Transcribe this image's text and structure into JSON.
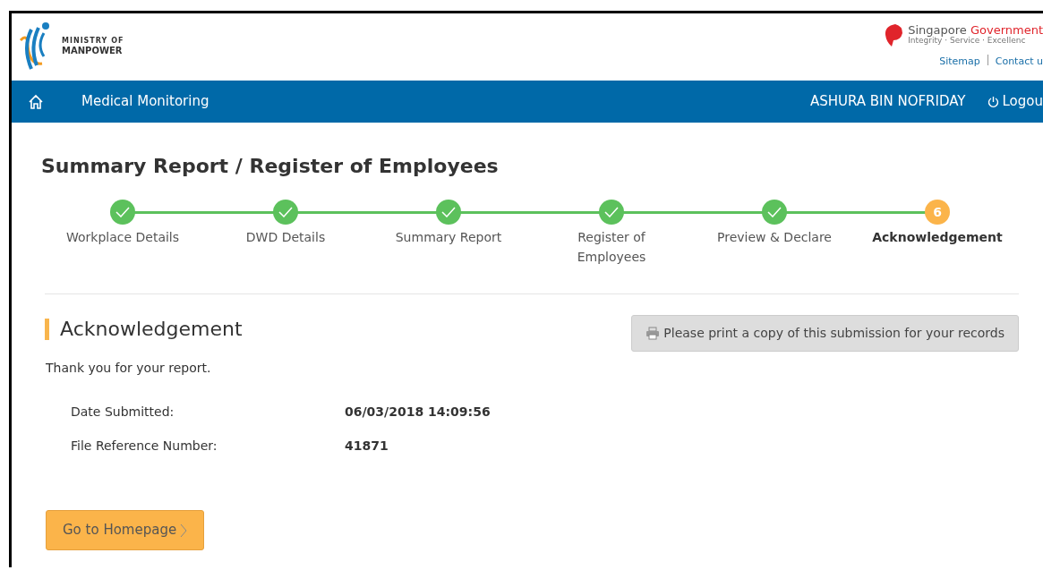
{
  "header": {
    "logo_line1": "MINISTRY OF",
    "logo_line2": "MANPOWER",
    "gov_name_1": "Singapore",
    "gov_name_2": "Government",
    "gov_tagline": "Integrity · Service · Excellenc",
    "links": [
      "Sitemap",
      "Contact u"
    ]
  },
  "navbar": {
    "title": "Medical Monitoring",
    "user": "ASHURA BIN NOFRIDAY",
    "logout": "Logou"
  },
  "page_title": "Summary Report / Register of Employees",
  "steps": [
    {
      "label": "Workplace Details",
      "completed": true,
      "selected": false
    },
    {
      "label": "DWD Details",
      "completed": true,
      "selected": false
    },
    {
      "label": "Summary Report",
      "completed": true,
      "selected": false
    },
    {
      "label": "Register of Employees",
      "completed": true,
      "selected": false
    },
    {
      "label": "Preview & Declare",
      "completed": true,
      "selected": false
    },
    {
      "label": "Acknowledgement",
      "completed": false,
      "selected": true,
      "number": "6"
    }
  ],
  "section_title": "Acknowledgement",
  "print_button": "Please print a copy of this submission for your records",
  "message": "Thank you for your report.",
  "details": [
    {
      "label": "Date Submitted:",
      "value": "06/03/2018 14:09:56"
    },
    {
      "label": "File Reference Number:",
      "value": "41871"
    }
  ],
  "home_button": "Go to Homepage"
}
